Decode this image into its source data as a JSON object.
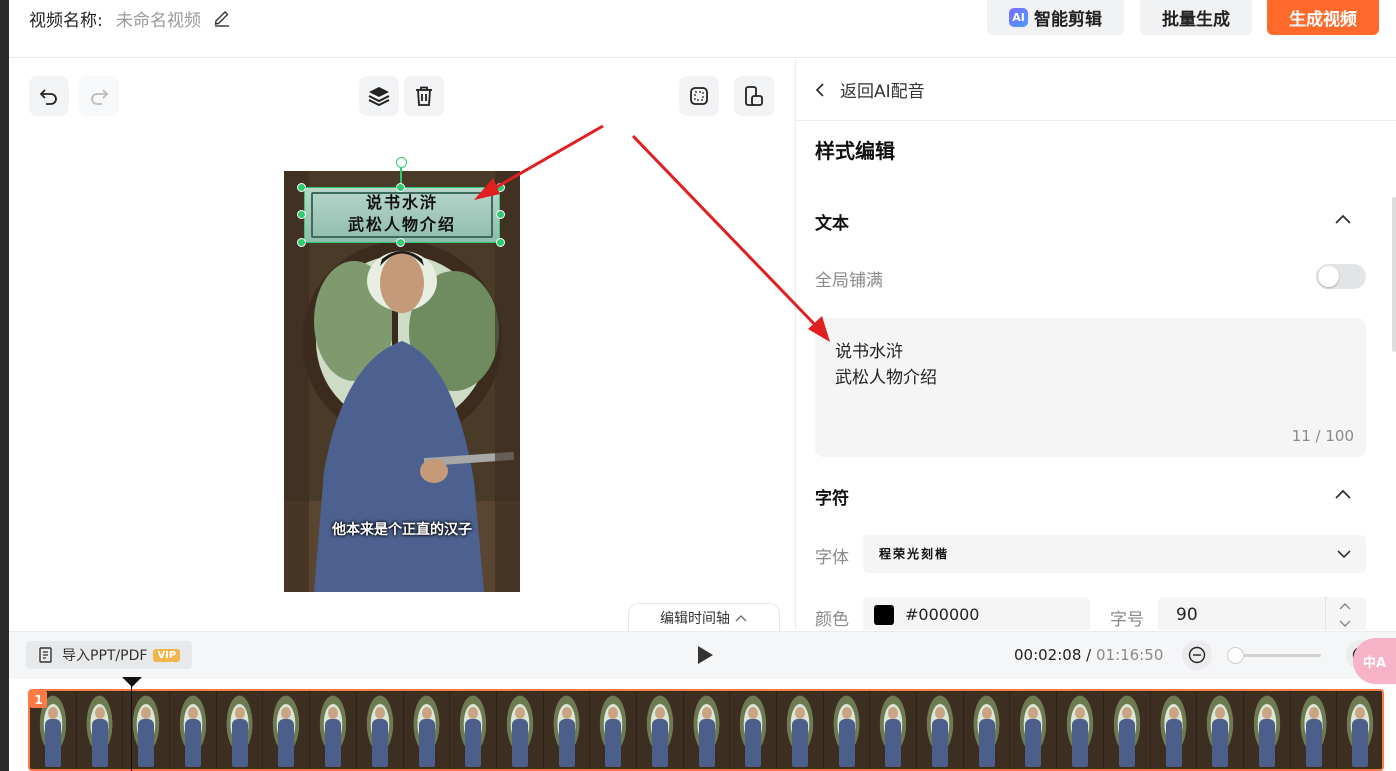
{
  "header": {
    "video_name_label": "视频名称:",
    "video_name_value": "未命名视频",
    "smart_edit_label": "智能剪辑",
    "ai_badge": "AI",
    "batch_generate_label": "批量生成",
    "generate_video_label": "生成视频"
  },
  "preview": {
    "title_text": "说书水浒\n武松人物介绍",
    "subtitle_text": "他本来是个正直的汉子"
  },
  "timeline_tab": {
    "label": "编辑时间轴"
  },
  "right_panel": {
    "back_label": "返回AI配音",
    "section_title": "样式编辑",
    "text_section": {
      "title": "文本",
      "fill_all_label": "全局铺满",
      "fill_all_on": false,
      "content": "说书水浒\n武松人物介绍",
      "counter": "11 / 100"
    },
    "char_section": {
      "title": "字符",
      "font_label": "字体",
      "font_value": "程荣光刻楷",
      "color_label": "颜色",
      "color_value": "#000000",
      "size_label": "字号",
      "size_value": "90"
    }
  },
  "bottom_bar": {
    "import_label": "导入PPT/PDF",
    "vip_badge": "VIP",
    "current_time": "00:02:08",
    "separator": "/",
    "total_time": "01:16:50"
  },
  "timeline": {
    "track_number": "1"
  },
  "floating": {
    "translate_label": "中A"
  },
  "colors": {
    "accent": "#ff6a2b",
    "selection": "#2ecc71",
    "track_border": "#ff7a45",
    "arrow": "#e02020"
  }
}
